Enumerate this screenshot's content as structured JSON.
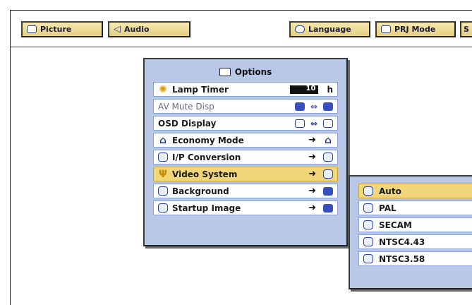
{
  "top_tabs": [
    {
      "label": "Picture",
      "icon": "monitor-icon"
    },
    {
      "label": "Audio",
      "icon": "speaker-icon"
    },
    {
      "label": "Language",
      "icon": "speech-bubble-icon"
    },
    {
      "label": "PRJ Mode",
      "icon": "projector-icon"
    },
    {
      "label": "S",
      "icon": ""
    }
  ],
  "options_menu": {
    "title": "Options",
    "title_icon": "briefcase-icon",
    "items": [
      {
        "label": "Lamp Timer",
        "icon": "lamp-icon",
        "value": "10",
        "unit": "h"
      },
      {
        "label": "AV Mute Disp",
        "disabled": true
      },
      {
        "label": "OSD Display"
      },
      {
        "label": "Economy Mode",
        "icon": "house-icon"
      },
      {
        "label": "I/P Conversion",
        "icon": "ip-icon"
      },
      {
        "label": "Video System",
        "icon": "antenna-icon",
        "selected": true
      },
      {
        "label": "Background",
        "icon": "background-icon"
      },
      {
        "label": "Startup Image",
        "icon": "startup-icon"
      }
    ]
  },
  "video_system_submenu": {
    "items": [
      {
        "label": "Auto",
        "selected": true
      },
      {
        "label": "PAL"
      },
      {
        "label": "SECAM"
      },
      {
        "label": "NTSC4.43"
      },
      {
        "label": "NTSC3.58"
      }
    ]
  },
  "colors": {
    "highlight": "#f2d77a",
    "menu_bg": "#b9c8e6",
    "tab_bg": "#e4cf7e"
  }
}
